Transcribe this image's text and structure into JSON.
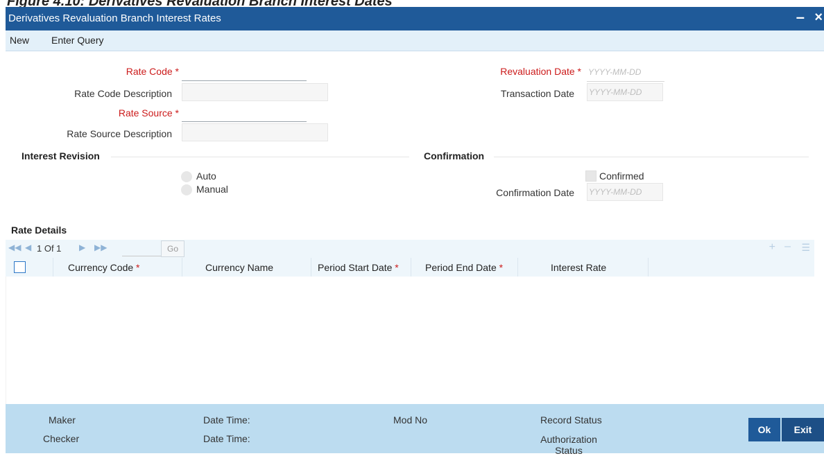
{
  "figure_caption": "Figure 4.10: Derivatives Revaluation Branch Interest Dates",
  "window": {
    "title": "Derivatives Revaluation Branch Interest Rates",
    "minimize_glyph": "–",
    "close_glyph": "×"
  },
  "menu": {
    "new": "New",
    "enter_query": "Enter Query"
  },
  "form": {
    "rate_code_label": "Rate Code",
    "rate_code_desc_label": "Rate Code Description",
    "rate_source_label": "Rate Source",
    "rate_source_desc_label": "Rate Source Description",
    "revaluation_date_label": "Revaluation Date",
    "transaction_date_label": "Transaction Date",
    "date_placeholder": "YYYY-MM-DD",
    "required_mark": "*"
  },
  "interest_revision": {
    "title": "Interest Revision",
    "auto": "Auto",
    "manual": "Manual"
  },
  "confirmation": {
    "title": "Confirmation",
    "confirmed": "Confirmed",
    "confirmation_date_label": "Confirmation Date"
  },
  "rate_details": {
    "title": "Rate Details",
    "pagination": "1 Of 1",
    "go": "Go",
    "columns": [
      "Currency Code",
      "Currency Name",
      "Period Start Date",
      "Period End Date",
      "Interest Rate"
    ],
    "required": [
      true,
      false,
      true,
      true,
      false
    ],
    "rows": []
  },
  "footer": {
    "maker": "Maker",
    "checker": "Checker",
    "date_time_1": "Date Time:",
    "date_time_2": "Date Time:",
    "mod_no": "Mod No",
    "record_status": "Record Status",
    "authorization_status": "Authorization Status",
    "ok": "Ok",
    "exit": "Exit"
  },
  "colors": {
    "title_bar": "#1f5a99",
    "menu_bar": "#e3f0f9",
    "footer": "#bcdcf0",
    "required": "#cc1b1b"
  }
}
